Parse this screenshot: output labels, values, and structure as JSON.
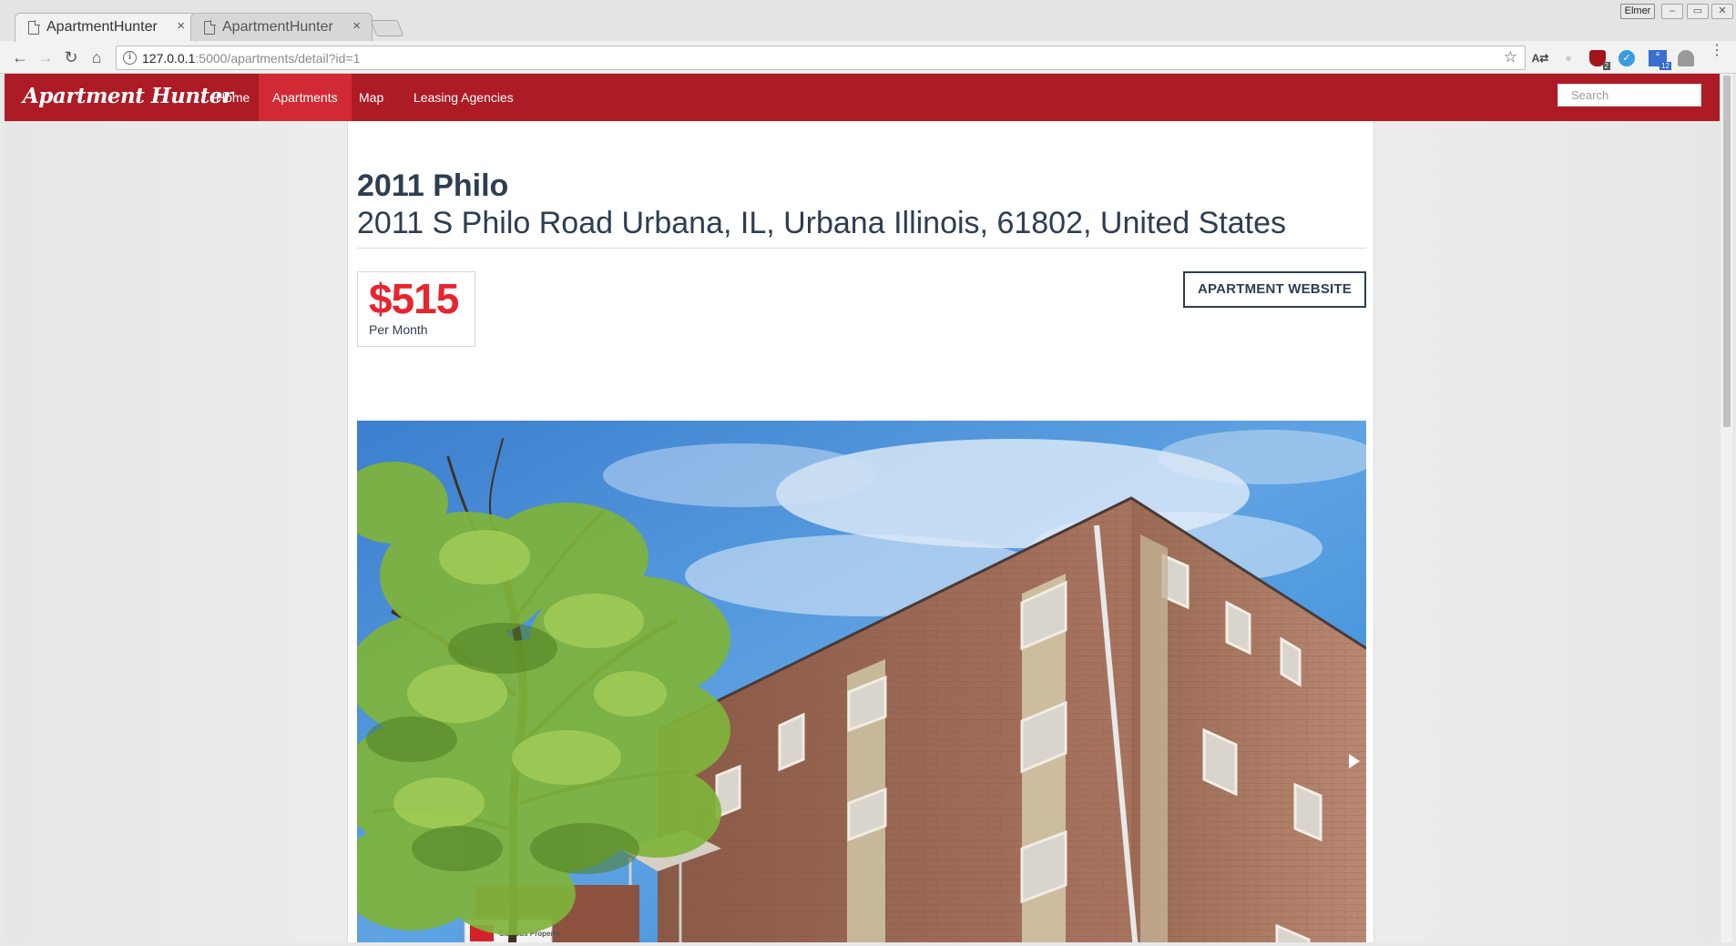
{
  "browser": {
    "tabs": [
      {
        "title": "ApartmentHunter",
        "close": "×",
        "active": true
      },
      {
        "title": "ApartmentHunter",
        "close": "×",
        "active": false
      }
    ],
    "profile_label": "Elmer",
    "url_host": "127.0.0.1",
    "url_rest": ":5000/apartments/detail?id=1",
    "window_controls": [
      "–",
      "▭",
      "✕"
    ]
  },
  "site": {
    "brand": "Apartment Hunter",
    "nav": [
      {
        "label": "Home",
        "active": false
      },
      {
        "label": "Apartments",
        "active": true
      },
      {
        "label": "Map",
        "active": false
      },
      {
        "label": "Leasing Agencies",
        "active": false
      }
    ],
    "search_placeholder": "Search"
  },
  "apartment": {
    "name": "2011 Philo",
    "address": "2011 S Philo Road Urbana, IL, Urbana Illinois, 61802, United States",
    "price": "$515",
    "price_period": "Per Month",
    "website_button": "APARTMENT WEBSITE",
    "photo_sign_text": "Campus Property"
  },
  "colors": {
    "navbar": "#ad1b25",
    "nav_active": "#d22a35",
    "price": "#e8242f",
    "text_dark": "#2c3e50"
  },
  "icons": [
    "page-icon",
    "back-icon",
    "forward-icon",
    "reload-icon",
    "home-icon",
    "info-icon",
    "star-icon",
    "translate-icon",
    "menu-icon",
    "carousel-next-icon"
  ]
}
